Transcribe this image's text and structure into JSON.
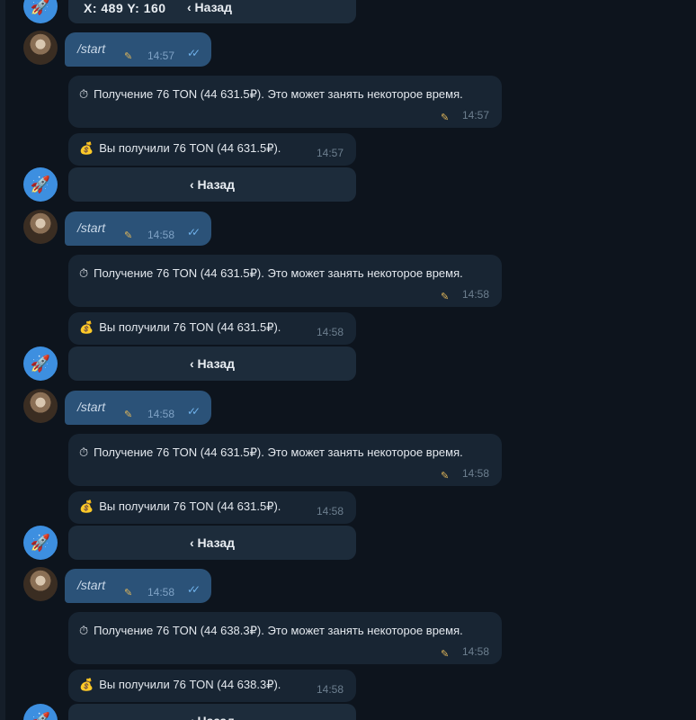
{
  "overlay": {
    "coords": "X: 489 Y: 160"
  },
  "icons": {
    "bot_avatar": "rocket-icon",
    "pencil": "pencil-icon",
    "read_checks": "double-check-icon",
    "stopwatch": "stopwatch-icon",
    "money_bag": "money-bag-icon"
  },
  "colors": {
    "background": "#0d141d",
    "outgoing_bubble": "#2b5278",
    "incoming_bubble": "#182533",
    "inline_button": "#1d2c3b",
    "bot_avatar": "#3d8fe0"
  },
  "back_label": "‹ Назад",
  "messages": [
    {
      "user_text": "/start",
      "user_time": "14:57",
      "pending_text": "Получение 76 TON (44 631.5₽). Это может занять некоторое время.",
      "pending_time": "14:57",
      "received_text": "Вы получили 76 TON (44 631.5₽).",
      "received_time": "14:57"
    },
    {
      "user_text": "/start",
      "user_time": "14:58",
      "pending_text": "Получение 76 TON (44 631.5₽). Это может занять некоторое время.",
      "pending_time": "14:58",
      "received_text": "Вы получили 76 TON (44 631.5₽).",
      "received_time": "14:58"
    },
    {
      "user_text": "/start",
      "user_time": "14:58",
      "pending_text": "Получение 76 TON (44 631.5₽). Это может занять некоторое время.",
      "pending_time": "14:58",
      "received_text": "Вы получили 76 TON (44 631.5₽).",
      "received_time": "14:58"
    },
    {
      "user_text": "/start",
      "user_time": "14:58",
      "pending_text": "Получение 76 TON (44 638.3₽). Это может занять некоторое время.",
      "pending_time": "14:58",
      "received_text": "Вы получили 76 TON (44 638.3₽).",
      "received_time": "14:58"
    }
  ]
}
